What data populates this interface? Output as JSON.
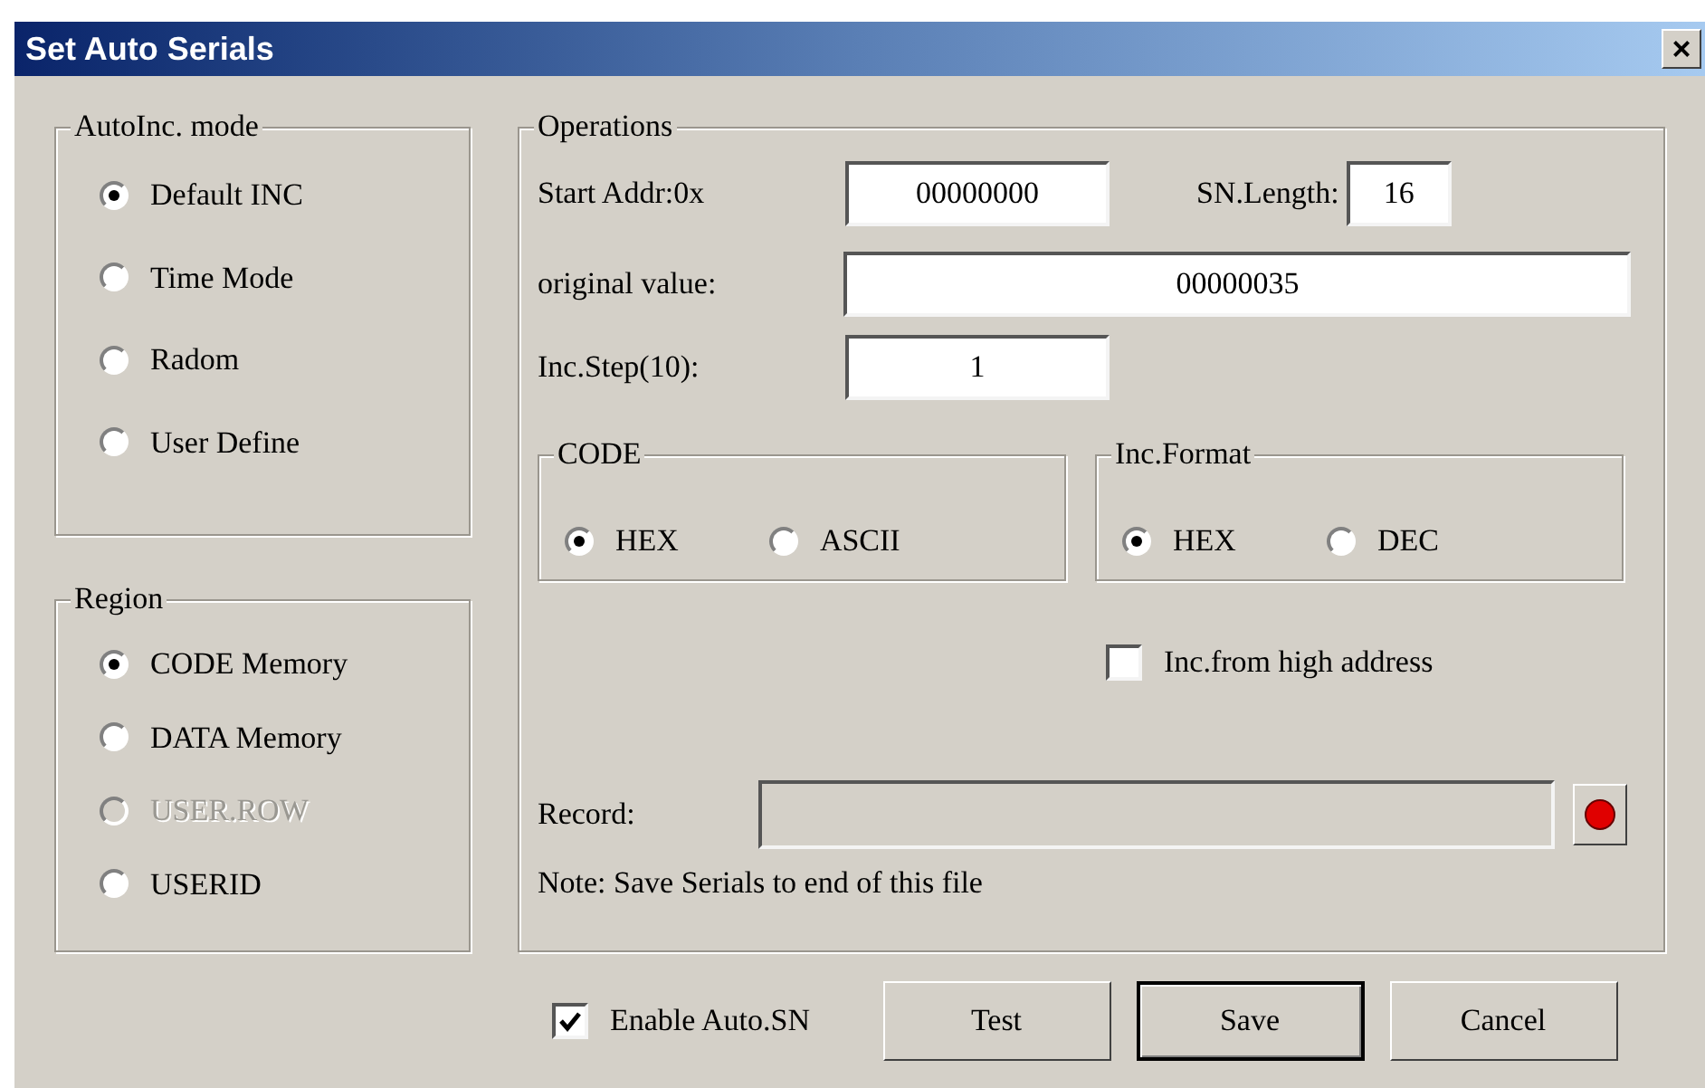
{
  "window": {
    "title": "Set Auto Serials",
    "close": "×"
  },
  "autoinc_mode": {
    "title": "AutoInc. mode",
    "options": [
      {
        "label": "Default INC",
        "selected": true,
        "disabled": false
      },
      {
        "label": "Time Mode",
        "selected": false,
        "disabled": false
      },
      {
        "label": "Radom",
        "selected": false,
        "disabled": false
      },
      {
        "label": "User Define",
        "selected": false,
        "disabled": false
      }
    ]
  },
  "region": {
    "title": "Region",
    "options": [
      {
        "label": "CODE Memory",
        "selected": true,
        "disabled": false
      },
      {
        "label": "DATA Memory",
        "selected": false,
        "disabled": false
      },
      {
        "label": "USER.ROW",
        "selected": false,
        "disabled": true
      },
      {
        "label": "USERID",
        "selected": false,
        "disabled": false
      }
    ]
  },
  "operations": {
    "title": "Operations",
    "start_addr": {
      "label": "Start Addr:0x",
      "value": "00000000"
    },
    "sn_length": {
      "label": "SN.Length:",
      "value": "16"
    },
    "original_value": {
      "label": "original value:",
      "value": "00000035"
    },
    "inc_step": {
      "label": "Inc.Step(10):",
      "value": "1"
    },
    "code": {
      "title": "CODE",
      "options": [
        {
          "label": "HEX",
          "selected": true
        },
        {
          "label": "ASCII",
          "selected": false
        }
      ]
    },
    "inc_format": {
      "title": "Inc.Format",
      "options": [
        {
          "label": "HEX",
          "selected": true
        },
        {
          "label": "DEC",
          "selected": false
        }
      ]
    },
    "inc_from_high": {
      "label": "Inc.from high address",
      "checked": false
    },
    "record": {
      "label": "Record:"
    },
    "note": "Note: Save Serials to end of this file"
  },
  "enable_auto_sn": {
    "label": "Enable Auto.SN",
    "checked": true
  },
  "buttons": [
    {
      "label": "Test",
      "default": false
    },
    {
      "label": "Save",
      "default": true
    },
    {
      "label": "Cancel",
      "default": false
    }
  ]
}
